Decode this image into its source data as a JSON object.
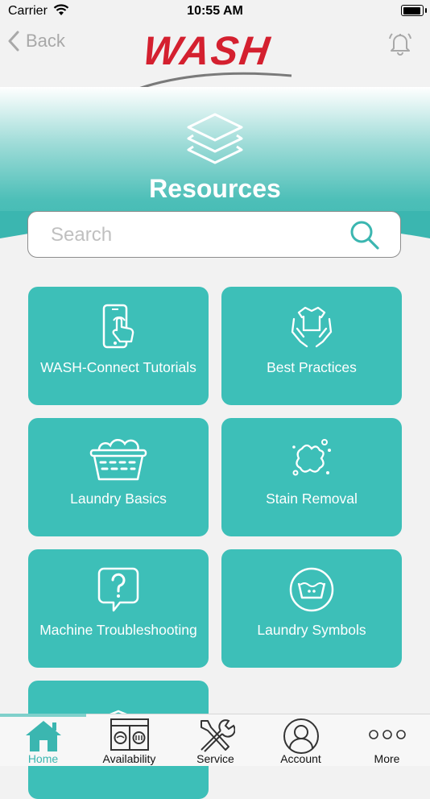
{
  "status_bar": {
    "carrier": "Carrier",
    "time": "10:55 AM"
  },
  "nav": {
    "back_label": "Back",
    "logo_text": "WASH"
  },
  "page": {
    "title": "Resources"
  },
  "search": {
    "placeholder": "Search",
    "value": ""
  },
  "tiles": [
    {
      "label": "WASH-Connect Tutorials",
      "icon": "phone-tap-icon"
    },
    {
      "label": "Best Practices",
      "icon": "hands-shirt-icon"
    },
    {
      "label": "Laundry Basics",
      "icon": "laundry-basket-icon"
    },
    {
      "label": "Stain Removal",
      "icon": "stain-splat-icon"
    },
    {
      "label": "Machine Troubleshooting",
      "icon": "question-bubble-icon"
    },
    {
      "label": "Laundry Symbols",
      "icon": "wash-symbol-icon"
    },
    {
      "label": "",
      "icon": "folded-laundry-icon"
    }
  ],
  "tabs": [
    {
      "label": "Home",
      "icon": "home-icon",
      "active": true
    },
    {
      "label": "Availability",
      "icon": "washer-dryer-icon",
      "active": false
    },
    {
      "label": "Service",
      "icon": "tools-icon",
      "active": false
    },
    {
      "label": "Account",
      "icon": "user-icon",
      "active": false
    },
    {
      "label": "More",
      "icon": "more-dots-icon",
      "active": false
    }
  ],
  "colors": {
    "accent": "#3dbfb8",
    "brand_red": "#d4202f"
  }
}
